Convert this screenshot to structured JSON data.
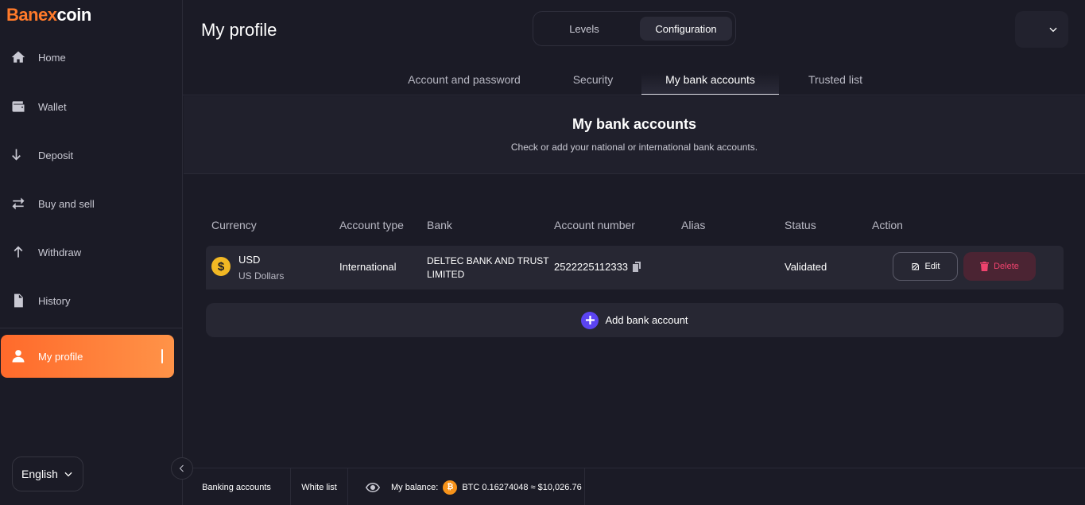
{
  "brand": {
    "name_main": "Banex",
    "name_accent": "coin"
  },
  "sidebar": {
    "items": [
      {
        "label": "Home",
        "icon": "home-icon"
      },
      {
        "label": "Wallet",
        "icon": "wallet-icon"
      },
      {
        "label": "Deposit",
        "icon": "deposit-icon"
      },
      {
        "label": "Buy and sell",
        "icon": "swap-icon"
      },
      {
        "label": "Withdraw",
        "icon": "withdraw-icon"
      },
      {
        "label": "History",
        "icon": "history-icon"
      }
    ],
    "active": {
      "label": "My profile",
      "icon": "user-icon"
    },
    "language": "English"
  },
  "header": {
    "title": "My profile",
    "segments": [
      "Levels",
      "Configuration"
    ],
    "active_segment": "Configuration"
  },
  "tabs": [
    {
      "label": "Account and password"
    },
    {
      "label": "Security"
    },
    {
      "label": "My bank accounts"
    },
    {
      "label": "Trusted list"
    }
  ],
  "active_tab": "My bank accounts",
  "section": {
    "title": "My bank accounts",
    "subtitle": "Check or add your national or international bank accounts."
  },
  "table": {
    "columns": [
      "Currency",
      "Account type",
      "Bank",
      "Account number",
      "Alias",
      "Status",
      "Action"
    ],
    "rows": [
      {
        "currency_code": "USD",
        "currency_name": "US Dollars",
        "currency_symbol": "$",
        "account_type": "International",
        "bank": "DELTEC BANK AND TRUST LIMITED",
        "account_number": "2522225112333",
        "alias": "",
        "status": "Validated",
        "edit_label": "Edit",
        "delete_label": "Delete"
      }
    ],
    "add_label": "Add bank account"
  },
  "footer": {
    "banking_accounts": "Banking accounts",
    "white_list": "White list",
    "balance_label": "My balance:",
    "btc_symbol": "₿",
    "balance_value": "BTC 0.16274048 ≈ $10,026.76"
  },
  "colors": {
    "accent_orange": "#ff7a2a",
    "background": "#1b1b26",
    "delete_red": "#f0436e",
    "add_purple": "#5b44f2",
    "usd_gold": "#f2b824",
    "btc_orange": "#f7931a"
  }
}
